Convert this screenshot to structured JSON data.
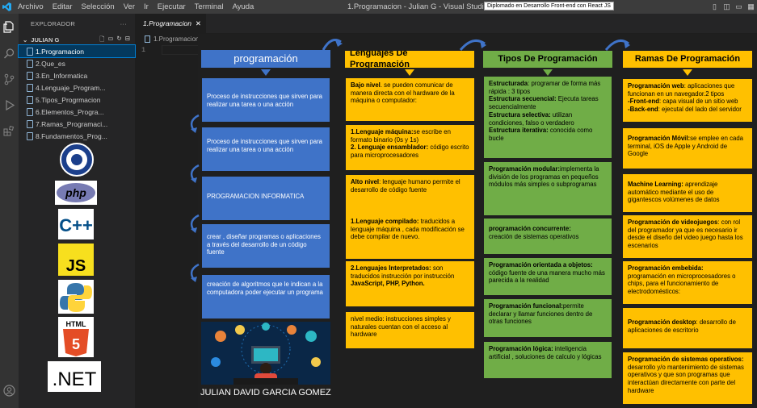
{
  "menu": [
    "Archivo",
    "Editar",
    "Selección",
    "Ver",
    "Ir",
    "Ejecutar",
    "Terminal",
    "Ayuda"
  ],
  "window_title": "1.Programacion - Julian G - Visual Studio Code",
  "tooltip": "Diplomado en Desarrollo Front-end con React JS",
  "sidebar": {
    "title": "EXPLORADOR",
    "folder": "JULIAN G",
    "files": [
      "1.Programacion",
      "2.Que_es",
      "3.En_Informatica",
      "4.Lenguaje_Program...",
      "5.Tipos_Progrmacion",
      "6.Elementos_Progra...",
      "7.Ramas_Programaci...",
      "8.Fundamentos_Prog..."
    ]
  },
  "logos": [
    "php",
    "C++",
    "JS",
    "HTML",
    "5",
    ".NET"
  ],
  "editor": {
    "tab": "1.Programacion",
    "breadcrumb": "1.Programacion",
    "line_number": "1"
  },
  "board": {
    "headers": [
      "programación",
      "Lenguajes De Programación",
      "Tipos De Programación",
      "Ramas De Programación"
    ],
    "blue": [
      "Proceso de instrucciones que sirven para realizar una tarea o una acción",
      "Proceso de instrucciones que sirven para realizar una tarea o una acción",
      "PROGRAMACION INFORMATICA",
      "crear , diseñar programas o aplicaciones a través del desarrollo de un código fuente",
      "creación de algoritmos que le indican a la  computadora poder ejecutar un programa"
    ],
    "yellow": [
      {
        "b": "Bajo nivel",
        "t": ". se pueden comunicar de manera directa con el hardware de la máquina o computador:"
      },
      {
        "b": "1.Lenguaje máquina:",
        "t": "se escribe en formato binario (0s y 1s)",
        "b2": "2. Lenguaje ensamblador:",
        "t2": "  código escrito para microprocesadores"
      },
      {
        "b": "Alto nivel",
        "t": ": lenguaje humano  permite el desarrollo de código fuente"
      },
      {
        "b": "1.Lenguaje compilado:",
        "t": " traducidos a lenguaje máquina , cada modificación se debe compilar de nuevo."
      },
      {
        "b": "2.Lenguajes Interpretados:",
        "t": " son traducidos instrucción por instrucción ",
        "b2": "JavaScript, PHP, Python."
      },
      {
        "b": "",
        "t": "nivel medio: instrucciones simples y naturales cuentan con el acceso al hardware"
      }
    ],
    "green": [
      {
        "lines": [
          {
            "b": "Estructurada",
            "t": ": programar de forma más rápida : 3 tipos"
          },
          {
            "b": "Estructura secuencial:",
            "t": " Ejecuta tareas secuencialmente"
          },
          {
            "b": "Estructura selectiva:",
            "t": " utilizan condiciones, falso o verdadero"
          },
          {
            "b": "Estructura iterativa:",
            "t": " conocida como bucle"
          }
        ]
      },
      {
        "b": "Programación modular:",
        "t": "implementa la división de los programas en pequeños módulos más simples o subprogramas"
      },
      {
        "b": "programación concurrente:",
        "t": "creación de sistemas operativos"
      },
      {
        "b": "Programación orientada a objetos:",
        "t": "código fuente de una manera mucho más parecida a la realidad"
      },
      {
        "b": "Programación funcional:",
        "t": "permite declarar y llamar funciones dentro de otras funciones"
      },
      {
        "b": "Programación lógica:",
        "t": " inteligencia artificial , soluciones de calculo y lógicas"
      }
    ],
    "ramas": [
      {
        "b": "Programación web",
        "t": ": aplicaciones que funcionan en un navegador.2 tipos",
        "b2": "-Front-end",
        "t2": ": capa visual de un sitio web",
        "b3": "-Back-end",
        "t3": ": ejecutal del lado del servidor"
      },
      {
        "b": "Programación Móvil:",
        "t": "se emplee en cada terminal, iOS de Apple y Android de Google"
      },
      {
        "b": "Machine Learning:",
        "t": " aprendizaje automático mediante el uso de gigantescos volúmenes de datos"
      },
      {
        "b": "Programación de videojuegos",
        "t": ": con rol del programador ya que es necesario ir desde el diseño del video juego hasta los escenarios"
      },
      {
        "b": "Programación embebida:",
        "t": "programación en microprocesadores o chips, para el funcionamiento de electrodomésticos:"
      },
      {
        "b": "Programación desktop",
        "t": ": desarrollo de aplicaciones de escritorio"
      },
      {
        "b": "Programación de sistemas operativos:",
        "t": " desarrollo y/o mantenimiento de sistemas operativos y que son programas que interactúan directamente con parte del hardware"
      }
    ],
    "author": "JULIAN DAVID GARCIA GOMEZ"
  }
}
